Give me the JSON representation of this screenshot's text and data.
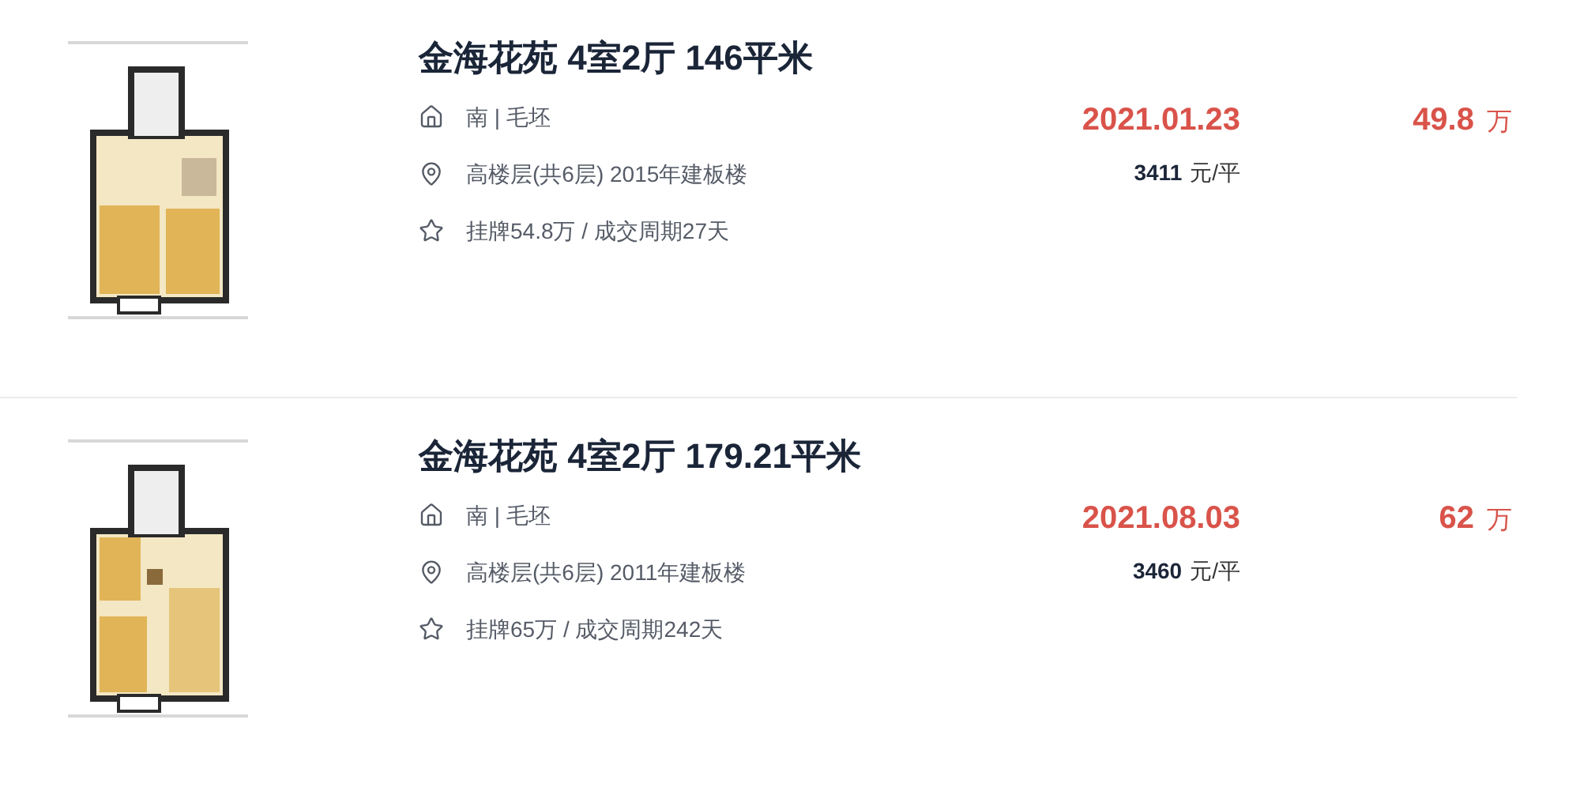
{
  "listings": [
    {
      "kind": "picture",
      "title": "金海花苑 4室2厅 146平米",
      "orientation": "南 | 毛坯",
      "floor": "高楼层(共6层) 2015年建板楼",
      "listing_info": "挂牌54.8万 / 成交周期27天",
      "deal_date": "2021.01.23",
      "unit_price": "3411",
      "unit_price_unit": "元/平",
      "total_price": "49.8",
      "total_price_unit": "万"
    },
    {
      "kind": "picture",
      "title": "金海花苑 4室2厅 179.21平米",
      "orientation": "南 | 毛坯",
      "floor": "高楼层(共6层) 2011年建板楼",
      "listing_info": "挂牌65万 / 成交周期242天",
      "deal_date": "2021.08.03",
      "unit_price": "3460",
      "unit_price_unit": "元/平",
      "total_price": "62",
      "total_price_unit": "万"
    }
  ]
}
